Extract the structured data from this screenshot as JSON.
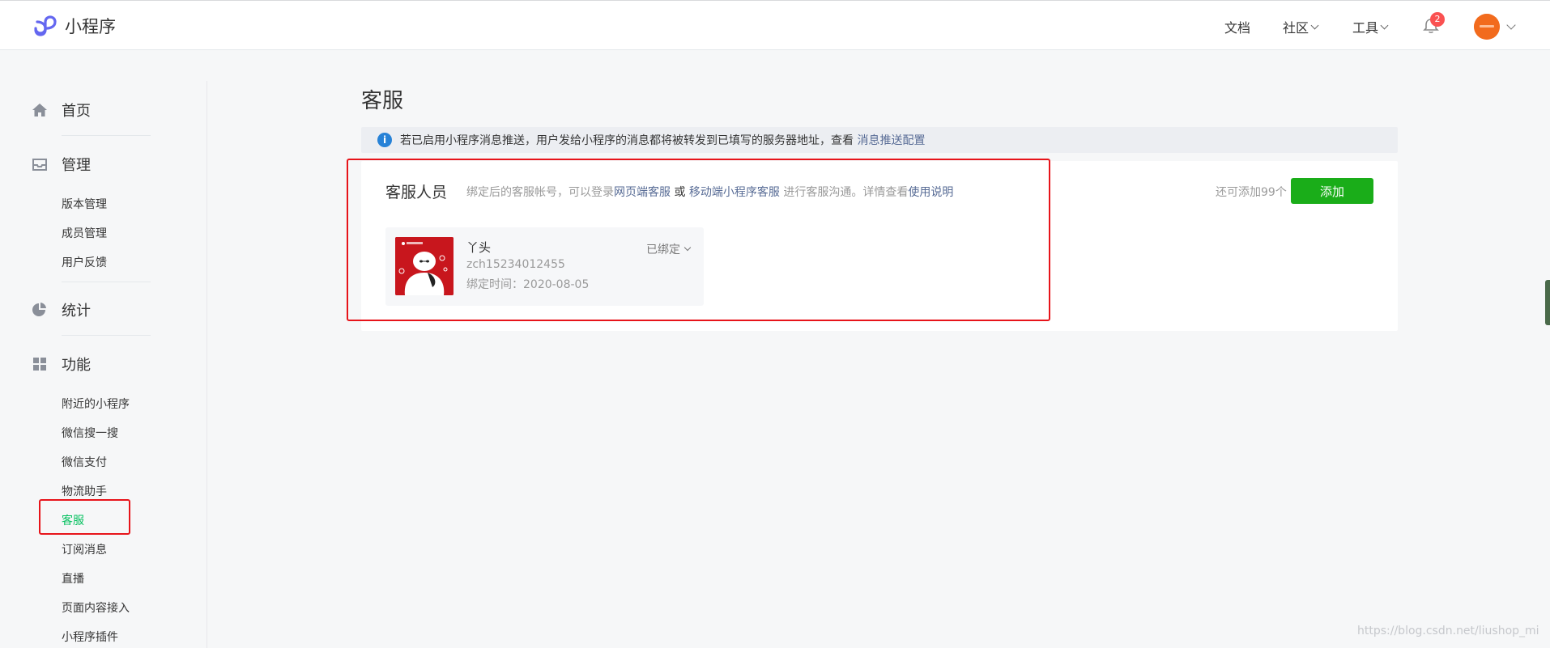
{
  "header": {
    "logo_text": "小程序",
    "nav": {
      "docs": "文档",
      "community": "社区",
      "tools": "工具"
    },
    "notification_count": "2",
    "avatar_text": "avatar"
  },
  "sidebar": {
    "home": "首页",
    "manage": {
      "label": "管理",
      "items": [
        "版本管理",
        "成员管理",
        "用户反馈"
      ]
    },
    "stats": "统计",
    "features": {
      "label": "功能",
      "items": [
        "附近的小程序",
        "微信搜一搜",
        "微信支付",
        "物流助手",
        "客服",
        "订阅消息",
        "直播",
        "页面内容接入",
        "小程序插件"
      ]
    },
    "active_item": "客服"
  },
  "main": {
    "title": "客服",
    "notice": {
      "text": "若已启用小程序消息推送，用户发给小程序的消息都将被转发到已填写的服务器地址，查看 ",
      "link": "消息推送配置"
    },
    "card": {
      "title": "客服人员",
      "desc_prefix": "绑定后的客服帐号，可以登录",
      "link_web": "网页端客服",
      "desc_or": " 或 ",
      "link_mobile": "移动端小程序客服",
      "desc_middle": " 进行客服沟通。详情查看",
      "link_help": "使用说明",
      "remaining": "还可添加99个",
      "add_button": "添加",
      "member": {
        "name": "丫头",
        "id": "zch15234012455",
        "bind_date": "绑定时间：2020-08-05",
        "status": "已绑定"
      }
    }
  },
  "watermark": "https://blog.csdn.net/liushop_mi",
  "colors": {
    "accent": "#1aad19",
    "active": "#07c160",
    "link": "#576b95",
    "highlight": "#e7141a"
  }
}
